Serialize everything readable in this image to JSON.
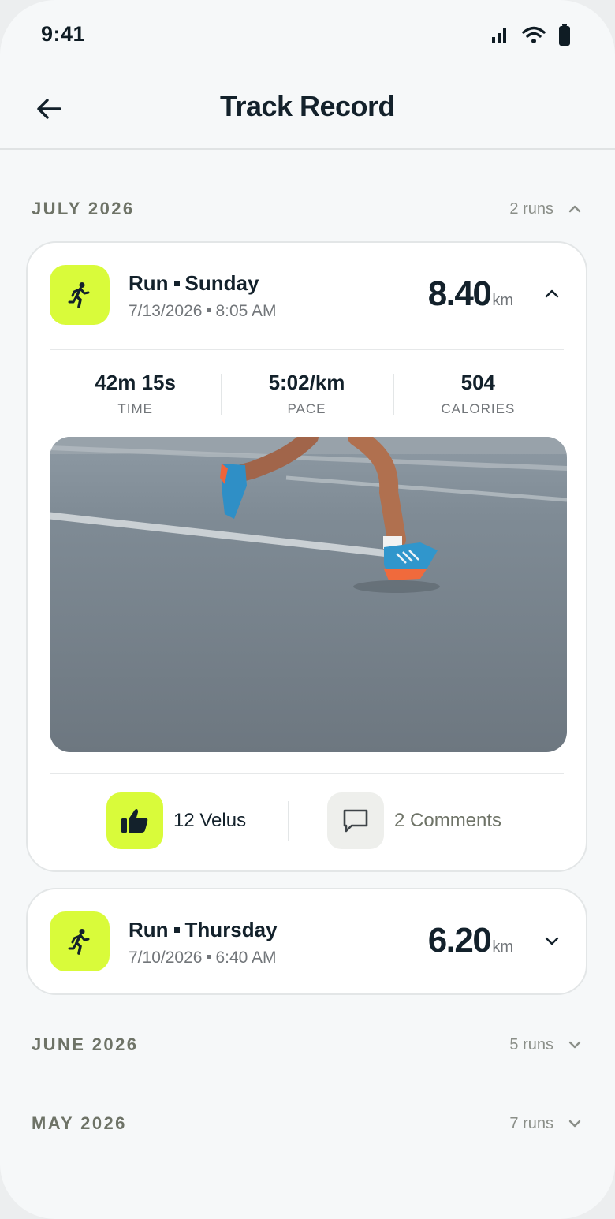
{
  "status_bar": {
    "time": "9:41"
  },
  "header": {
    "title": "Track Record"
  },
  "months": [
    {
      "title": "JULY 2026",
      "count": "2 runs",
      "expanded": true
    },
    {
      "title": "JUNE 2026",
      "count": "5 runs",
      "expanded": false
    },
    {
      "title": "MAY 2026",
      "count": "7 runs",
      "expanded": false
    }
  ],
  "runs": [
    {
      "activity": "Run",
      "day": "Sunday",
      "date": "7/13/2026",
      "time": "8:05 AM",
      "distance": "8.40",
      "unit": "km",
      "expanded": true,
      "stats": [
        {
          "value": "42m 15s",
          "label": "TIME"
        },
        {
          "value": "5:02/km",
          "label": "PACE"
        },
        {
          "value": "504",
          "label": "CALORIES"
        }
      ],
      "likes": "12 Velus",
      "comments": "2 Comments"
    },
    {
      "activity": "Run",
      "day": "Thursday",
      "date": "7/10/2026",
      "time": "6:40 AM",
      "distance": "6.20",
      "unit": "km",
      "expanded": false
    }
  ],
  "colors": {
    "accent": "#d9fb3a",
    "text": "#13212b",
    "muted": "#72767a",
    "background": "#f6f8f9"
  },
  "icons": [
    "back-arrow-icon",
    "signal-icon",
    "wifi-icon",
    "battery-icon",
    "runner-icon",
    "thumbs-up-icon",
    "comment-icon",
    "chevron-up-icon",
    "chevron-down-icon"
  ]
}
